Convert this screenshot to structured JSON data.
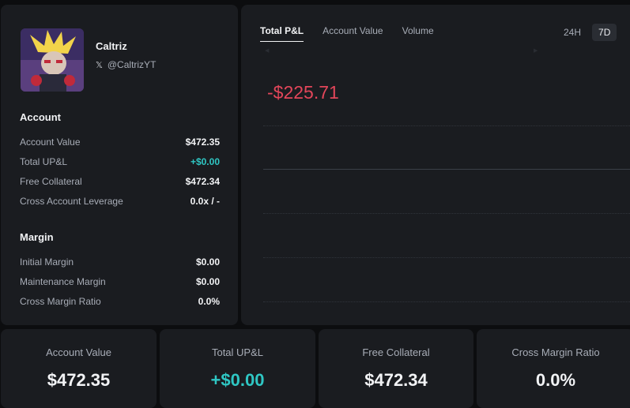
{
  "profile": {
    "name": "Caltriz",
    "handle": "@CaltrizYT"
  },
  "account": {
    "title": "Account",
    "rows": [
      {
        "label": "Account Value",
        "value": "$472.35"
      },
      {
        "label": "Total UP&L",
        "value": "+$0.00"
      },
      {
        "label": "Free Collateral",
        "value": "$472.34"
      },
      {
        "label": "Cross Account Leverage",
        "value": "0.0x / -"
      }
    ]
  },
  "margin": {
    "title": "Margin",
    "rows": [
      {
        "label": "Initial Margin",
        "value": "$0.00"
      },
      {
        "label": "Maintenance Margin",
        "value": "$0.00"
      },
      {
        "label": "Cross Margin Ratio",
        "value": "0.0%"
      }
    ]
  },
  "chart": {
    "tabs": [
      "Total P&L",
      "Account Value",
      "Volume"
    ],
    "active_tab": "Total P&L",
    "ranges": [
      "24H",
      "7D"
    ],
    "active_range": "7D",
    "pnl_value": "-$225.71",
    "pnl_color": "#e2465a"
  },
  "cards": [
    {
      "label": "Account Value",
      "value": "$472.35"
    },
    {
      "label": "Total UP&L",
      "value": "+$0.00"
    },
    {
      "label": "Free Collateral",
      "value": "$472.34"
    },
    {
      "label": "Cross Margin Ratio",
      "value": "0.0%"
    }
  ],
  "colors": {
    "positive": "#2fc7c4",
    "negative": "#e2465a",
    "panel": "#1a1c20",
    "background": "#0c0d0f"
  },
  "icons": {
    "x_logo": "𝕏"
  }
}
